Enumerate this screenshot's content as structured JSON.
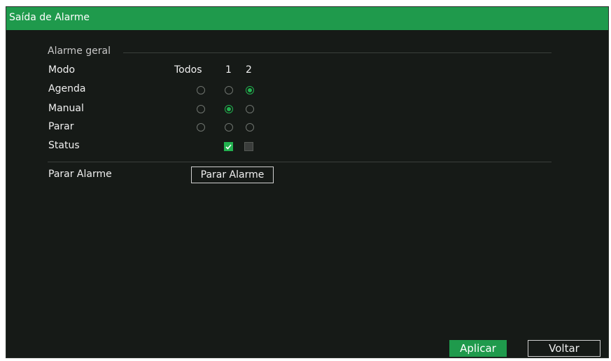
{
  "window": {
    "title": "Saída de Alarme"
  },
  "group": {
    "title": "Alarme geral",
    "columns": [
      "Todos",
      "1",
      "2"
    ],
    "rows": [
      {
        "label": "Modo"
      },
      {
        "label": "Agenda",
        "selected": "2"
      },
      {
        "label": "Manual",
        "selected": "1"
      },
      {
        "label": "Parar",
        "selected": ""
      },
      {
        "label": "Status",
        "status": [
          true,
          false
        ]
      }
    ]
  },
  "stop_alarm": {
    "label": "Parar Alarme",
    "button_label": "Parar Alarme"
  },
  "footer": {
    "apply_label": "Aplicar",
    "back_label": "Voltar"
  },
  "colors": {
    "accent": "#1f9a4c",
    "background": "#161a17"
  }
}
